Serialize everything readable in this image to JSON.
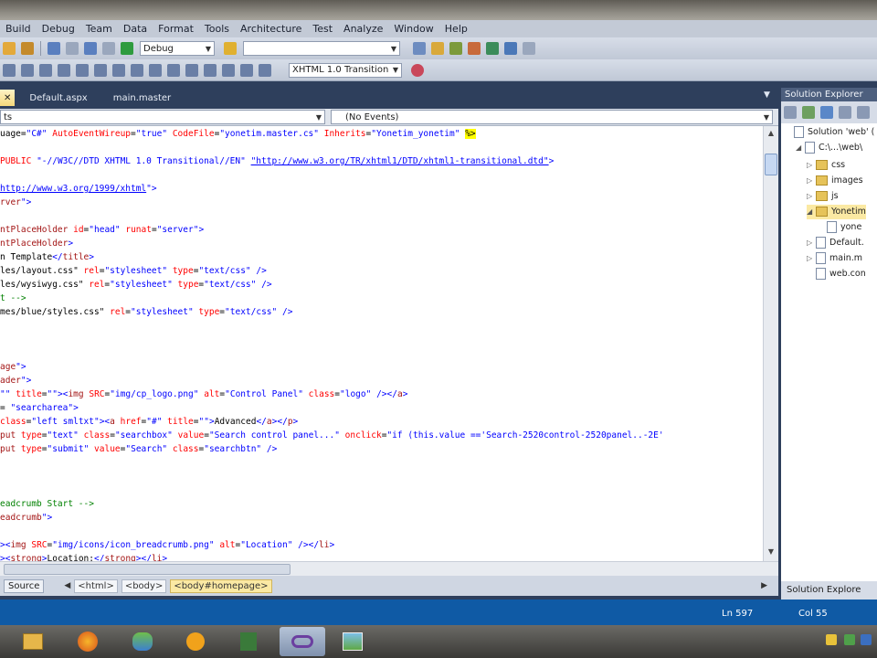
{
  "menu": [
    "Build",
    "Debug",
    "Team",
    "Data",
    "Format",
    "Tools",
    "Architecture",
    "Test",
    "Analyze",
    "Window",
    "Help"
  ],
  "toolbar": {
    "config_value": "Debug",
    "find_value": "",
    "doctype_value": "XHTML 1.0 Transition"
  },
  "tabs": [
    "Default.aspx",
    "main.master"
  ],
  "nav": {
    "left_value": "ts",
    "right_value": "(No Events)"
  },
  "code": [
    [
      [
        "p",
        "uage="
      ],
      [
        "v",
        "\"C#\""
      ],
      [
        "p",
        " "
      ],
      [
        "a",
        "AutoEventWireup"
      ],
      [
        "p",
        "="
      ],
      [
        "v",
        "\"true\""
      ],
      [
        "p",
        " "
      ],
      [
        "a",
        "CodeFile"
      ],
      [
        "p",
        "="
      ],
      [
        "v",
        "\"yonetim.master.cs\""
      ],
      [
        "p",
        " "
      ],
      [
        "a",
        "Inherits"
      ],
      [
        "p",
        "="
      ],
      [
        "v",
        "\"Yonetim_yonetim\""
      ],
      [
        "p",
        " "
      ],
      [
        "hl",
        "%>"
      ]
    ],
    [],
    [
      [
        "a",
        "PUBLIC"
      ],
      [
        "p",
        " "
      ],
      [
        "v",
        "\"-//W3C//DTD XHTML 1.0 Transitional//EN\""
      ],
      [
        "p",
        " "
      ],
      [
        "u",
        "\"http://www.w3.org/TR/xhtml1/DTD/xhtml1-transitional.dtd\""
      ],
      [
        "v",
        ">"
      ]
    ],
    [],
    [
      [
        "u",
        "http://www.w3.org/1999/xhtml"
      ],
      [
        "v",
        "\">"
      ]
    ],
    [
      [
        "t",
        "rver"
      ],
      [
        "v",
        "\">"
      ]
    ],
    [],
    [
      [
        "t",
        "ntPlaceHolder"
      ],
      [
        "p",
        " "
      ],
      [
        "a",
        "id"
      ],
      [
        "p",
        "="
      ],
      [
        "v",
        "\"head\""
      ],
      [
        "p",
        " "
      ],
      [
        "a",
        "runat"
      ],
      [
        "p",
        "="
      ],
      [
        "v",
        "\"server\""
      ],
      [
        "v",
        ">"
      ]
    ],
    [
      [
        "t",
        "ntPlaceHolder"
      ],
      [
        "v",
        ">"
      ]
    ],
    [
      [
        "p",
        "n Template"
      ],
      [
        "v",
        "</"
      ],
      [
        "t",
        "title"
      ],
      [
        "v",
        ">"
      ]
    ],
    [
      [
        "p",
        "les/layout.css\""
      ],
      [
        "p",
        " "
      ],
      [
        "a",
        "rel"
      ],
      [
        "p",
        "="
      ],
      [
        "v",
        "\"stylesheet\""
      ],
      [
        "p",
        " "
      ],
      [
        "a",
        "type"
      ],
      [
        "p",
        "="
      ],
      [
        "v",
        "\"text/css\""
      ],
      [
        "p",
        " "
      ],
      [
        "v",
        "/>"
      ]
    ],
    [
      [
        "p",
        "les/wysiwyg.css\""
      ],
      [
        "p",
        " "
      ],
      [
        "a",
        "rel"
      ],
      [
        "p",
        "="
      ],
      [
        "v",
        "\"stylesheet\""
      ],
      [
        "p",
        " "
      ],
      [
        "a",
        "type"
      ],
      [
        "p",
        "="
      ],
      [
        "v",
        "\"text/css\""
      ],
      [
        "p",
        " "
      ],
      [
        "v",
        "/>"
      ]
    ],
    [
      [
        "c",
        "t -->"
      ]
    ],
    [
      [
        "p",
        "mes/blue/styles.css\""
      ],
      [
        "p",
        " "
      ],
      [
        "a",
        "rel"
      ],
      [
        "p",
        "="
      ],
      [
        "v",
        "\"stylesheet\""
      ],
      [
        "p",
        " "
      ],
      [
        "a",
        "type"
      ],
      [
        "p",
        "="
      ],
      [
        "v",
        "\"text/css\""
      ],
      [
        "p",
        " "
      ],
      [
        "v",
        "/>"
      ]
    ],
    [],
    [],
    [],
    [
      [
        "t",
        "age"
      ],
      [
        "v",
        "\">"
      ]
    ],
    [
      [
        "t",
        "ader"
      ],
      [
        "v",
        "\">"
      ]
    ],
    [
      [
        "v",
        "\"\""
      ],
      [
        "p",
        " "
      ],
      [
        "a",
        "title"
      ],
      [
        "p",
        "="
      ],
      [
        "v",
        "\"\""
      ],
      [
        "v",
        "><"
      ],
      [
        "t",
        "img"
      ],
      [
        "p",
        " "
      ],
      [
        "a",
        "SRC"
      ],
      [
        "p",
        "="
      ],
      [
        "v",
        "\"img/cp_logo.png\""
      ],
      [
        "p",
        " "
      ],
      [
        "a",
        "alt"
      ],
      [
        "p",
        "="
      ],
      [
        "v",
        "\"Control Panel\""
      ],
      [
        "p",
        " "
      ],
      [
        "a",
        "class"
      ],
      [
        "p",
        "="
      ],
      [
        "v",
        "\"logo\""
      ],
      [
        "p",
        " "
      ],
      [
        "v",
        "/></"
      ],
      [
        "t",
        "a"
      ],
      [
        "v",
        ">"
      ]
    ],
    [
      [
        "p",
        "= "
      ],
      [
        "v",
        "\"searcharea\""
      ],
      [
        "v",
        ">"
      ]
    ],
    [
      [
        "a",
        "class"
      ],
      [
        "p",
        "="
      ],
      [
        "v",
        "\"left smltxt\""
      ],
      [
        "v",
        "><"
      ],
      [
        "t",
        "a"
      ],
      [
        "p",
        " "
      ],
      [
        "a",
        "href"
      ],
      [
        "p",
        "="
      ],
      [
        "v",
        "\"#\""
      ],
      [
        "p",
        " "
      ],
      [
        "a",
        "title"
      ],
      [
        "p",
        "="
      ],
      [
        "v",
        "\"\""
      ],
      [
        "v",
        ">"
      ],
      [
        "p",
        "Advanced"
      ],
      [
        "v",
        "</"
      ],
      [
        "t",
        "a"
      ],
      [
        "v",
        "></"
      ],
      [
        "t",
        "p"
      ],
      [
        "v",
        ">"
      ]
    ],
    [
      [
        "t",
        "put"
      ],
      [
        "p",
        " "
      ],
      [
        "a",
        "type"
      ],
      [
        "p",
        "="
      ],
      [
        "v",
        "\"text\""
      ],
      [
        "p",
        " "
      ],
      [
        "a",
        "class"
      ],
      [
        "p",
        "="
      ],
      [
        "v",
        "\"searchbox\""
      ],
      [
        "p",
        " "
      ],
      [
        "a",
        "value"
      ],
      [
        "p",
        "="
      ],
      [
        "v",
        "\"Search control panel...\""
      ],
      [
        "p",
        " "
      ],
      [
        "a",
        "onclick"
      ],
      [
        "p",
        "="
      ],
      [
        "v",
        "\"if (this.value =='Search-2520control-2520panel..-2E'"
      ]
    ],
    [
      [
        "t",
        "put"
      ],
      [
        "p",
        " "
      ],
      [
        "a",
        "type"
      ],
      [
        "p",
        "="
      ],
      [
        "v",
        "\"submit\""
      ],
      [
        "p",
        " "
      ],
      [
        "a",
        "value"
      ],
      [
        "p",
        "="
      ],
      [
        "v",
        "\"Search\""
      ],
      [
        "p",
        " "
      ],
      [
        "a",
        "class"
      ],
      [
        "p",
        "="
      ],
      [
        "v",
        "\"searchbtn\""
      ],
      [
        "p",
        " "
      ],
      [
        "v",
        "/>"
      ]
    ],
    [],
    [],
    [],
    [
      [
        "c",
        "eadcrumb Start -->"
      ]
    ],
    [
      [
        "t",
        "eadcrumb"
      ],
      [
        "v",
        "\">"
      ]
    ],
    [],
    [
      [
        "v",
        "><"
      ],
      [
        "t",
        "img"
      ],
      [
        "p",
        " "
      ],
      [
        "a",
        "SRC"
      ],
      [
        "p",
        "="
      ],
      [
        "v",
        "\"img/icons/icon_breadcrumb.png\""
      ],
      [
        "p",
        " "
      ],
      [
        "a",
        "alt"
      ],
      [
        "p",
        "="
      ],
      [
        "v",
        "\"Location\""
      ],
      [
        "p",
        " "
      ],
      [
        "v",
        "/></"
      ],
      [
        "t",
        "li"
      ],
      [
        "v",
        ">"
      ]
    ],
    [
      [
        "v",
        "><"
      ],
      [
        "t",
        "strong"
      ],
      [
        "v",
        ">"
      ],
      [
        "p",
        "Location:"
      ],
      [
        "v",
        "</"
      ],
      [
        "t",
        "strong"
      ],
      [
        "v",
        "></"
      ],
      [
        "t",
        "li"
      ],
      [
        "v",
        ">"
      ]
    ]
  ],
  "tagbar": {
    "source_label": "Source",
    "crumbs": [
      "<html>",
      "<body>",
      "<body#homepage>"
    ]
  },
  "solution_explorer": {
    "header": "Solution Explorer",
    "footer": "Solution Explore",
    "nodes": [
      {
        "label": "Solution 'web' (",
        "level": 0,
        "kind": "solution"
      },
      {
        "label": "C:\\...\\web\\",
        "level": 1,
        "kind": "project"
      },
      {
        "label": "css",
        "level": 2,
        "kind": "folder"
      },
      {
        "label": "images",
        "level": 2,
        "kind": "folder"
      },
      {
        "label": "js",
        "level": 2,
        "kind": "folder"
      },
      {
        "label": "Yonetim",
        "level": 2,
        "kind": "folder"
      },
      {
        "label": "yone",
        "level": 3,
        "kind": "file"
      },
      {
        "label": "Default.",
        "level": 2,
        "kind": "file"
      },
      {
        "label": "main.m",
        "level": 2,
        "kind": "file"
      },
      {
        "label": "web.con",
        "level": 2,
        "kind": "file"
      }
    ]
  },
  "status": {
    "line": "Ln 597",
    "col": "Col 55"
  }
}
